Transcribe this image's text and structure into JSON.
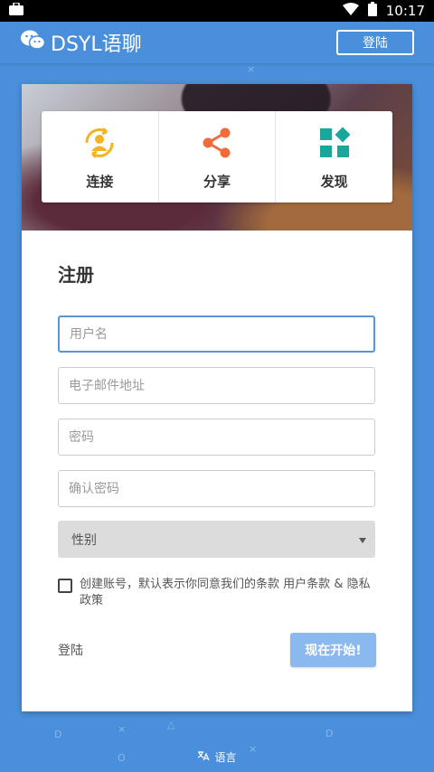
{
  "status_bar": {
    "time": "10:17"
  },
  "app_bar": {
    "brand": "DSYL语聊",
    "login_button": "登陆"
  },
  "features": [
    {
      "label": "连接",
      "icon": "connect-icon",
      "color": "#f5b324"
    },
    {
      "label": "分享",
      "icon": "share-icon",
      "color": "#f26b3a"
    },
    {
      "label": "发现",
      "icon": "discover-icon",
      "color": "#1aa69a"
    }
  ],
  "form": {
    "title": "注册",
    "username_placeholder": "用户名",
    "email_placeholder": "电子邮件地址",
    "password_placeholder": "密码",
    "confirm_placeholder": "确认密码",
    "gender_selected": "性别",
    "terms_text": "创建账号，默认表示你同意我们的条款",
    "terms_link": "用户条款",
    "terms_and": "&",
    "privacy_link": "隐私政策",
    "login_link": "登陆",
    "start_button": "现在开始!"
  },
  "footer": {
    "language": "语言"
  },
  "colors": {
    "background": "#4a8fdb",
    "accent": "#5b93d3",
    "button": "#8ab9ef"
  }
}
